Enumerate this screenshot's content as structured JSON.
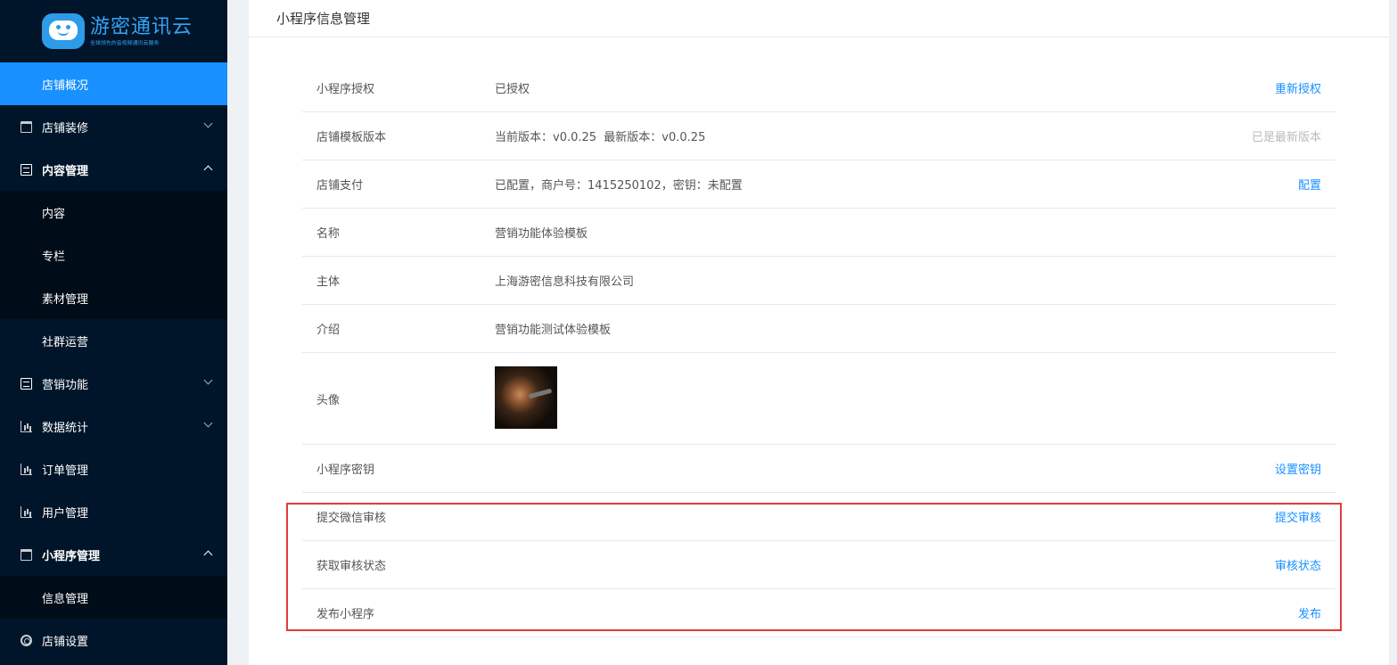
{
  "brand": {
    "title": "游密通讯云",
    "subtitle": "全球领先的音视频通讯云服务",
    "color": "#36a3f7"
  },
  "sidebar": {
    "items": [
      {
        "label": "店铺概况",
        "icon": "grid-icon"
      },
      {
        "label": "店铺装修",
        "icon": "shop-icon"
      },
      {
        "label": "内容管理",
        "icon": "document-icon"
      },
      {
        "label": "社群运营",
        "icon": "grid-icon"
      },
      {
        "label": "营销功能",
        "icon": "document-icon"
      },
      {
        "label": "数据统计",
        "icon": "bar-chart-icon"
      },
      {
        "label": "订单管理",
        "icon": "bar-chart-icon"
      },
      {
        "label": "用户管理",
        "icon": "bar-chart-icon"
      },
      {
        "label": "小程序管理",
        "icon": "shop-icon"
      },
      {
        "label": "店铺设置",
        "icon": "gear-icon"
      }
    ],
    "content_sub": [
      "内容",
      "专栏",
      "素材管理"
    ],
    "miniapp_sub": [
      "信息管理"
    ]
  },
  "page": {
    "title": "小程序信息管理"
  },
  "info_rows": {
    "auth": {
      "label": "小程序授权",
      "value": "已授权",
      "action": "重新授权"
    },
    "template": {
      "label": "店铺模板版本",
      "value": "当前版本：v0.0.25  最新版本：v0.0.25",
      "action": "已是最新版本"
    },
    "payment": {
      "label": "店铺支付",
      "value": "已配置，商户号：1415250102，密钥：未配置",
      "action": "配置"
    },
    "name": {
      "label": "名称",
      "value": "营销功能体验模板"
    },
    "subject": {
      "label": "主体",
      "value": "上海游密信息科技有限公司"
    },
    "intro": {
      "label": "介绍",
      "value": "营销功能测试体验模板"
    },
    "avatar": {
      "label": "头像"
    },
    "secret": {
      "label": "小程序密钥",
      "action": "设置密钥"
    },
    "submit": {
      "label": "提交微信审核",
      "action": "提交审核"
    },
    "status": {
      "label": "获取审核状态",
      "action": "审核状态"
    },
    "publish": {
      "label": "发布小程序",
      "action": "发布"
    }
  },
  "colors": {
    "sidebar_bg": "#001529",
    "active": "#1890ff",
    "highlight": "#e03b3b"
  }
}
